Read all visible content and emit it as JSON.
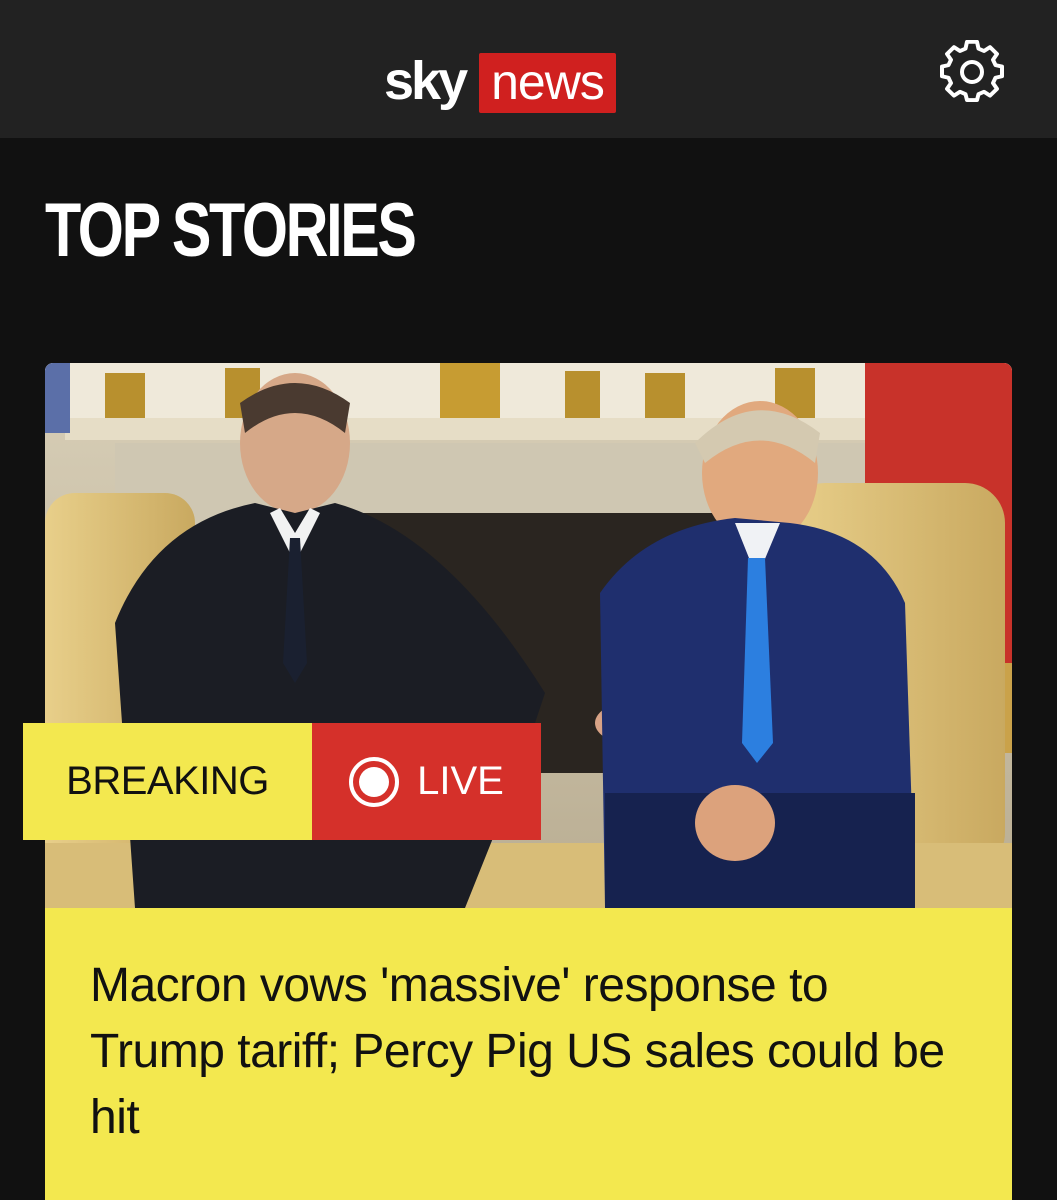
{
  "header": {
    "logo_sky": "sky",
    "logo_news": "news",
    "settings_icon": "gear-icon"
  },
  "section": {
    "title": "TOP STORIES"
  },
  "lead_story": {
    "image_icon": "news-photo",
    "badge_breaking": "BREAKING",
    "badge_live": "LIVE",
    "headline": "Macron vows 'massive' response to Trump tariff; Percy Pig US sales could be hit"
  },
  "colors": {
    "header_bg": "#222222",
    "page_bg": "#111111",
    "brand_red": "#d0201f",
    "breaking_yellow": "#f3e84f",
    "live_red": "#d5302a"
  }
}
